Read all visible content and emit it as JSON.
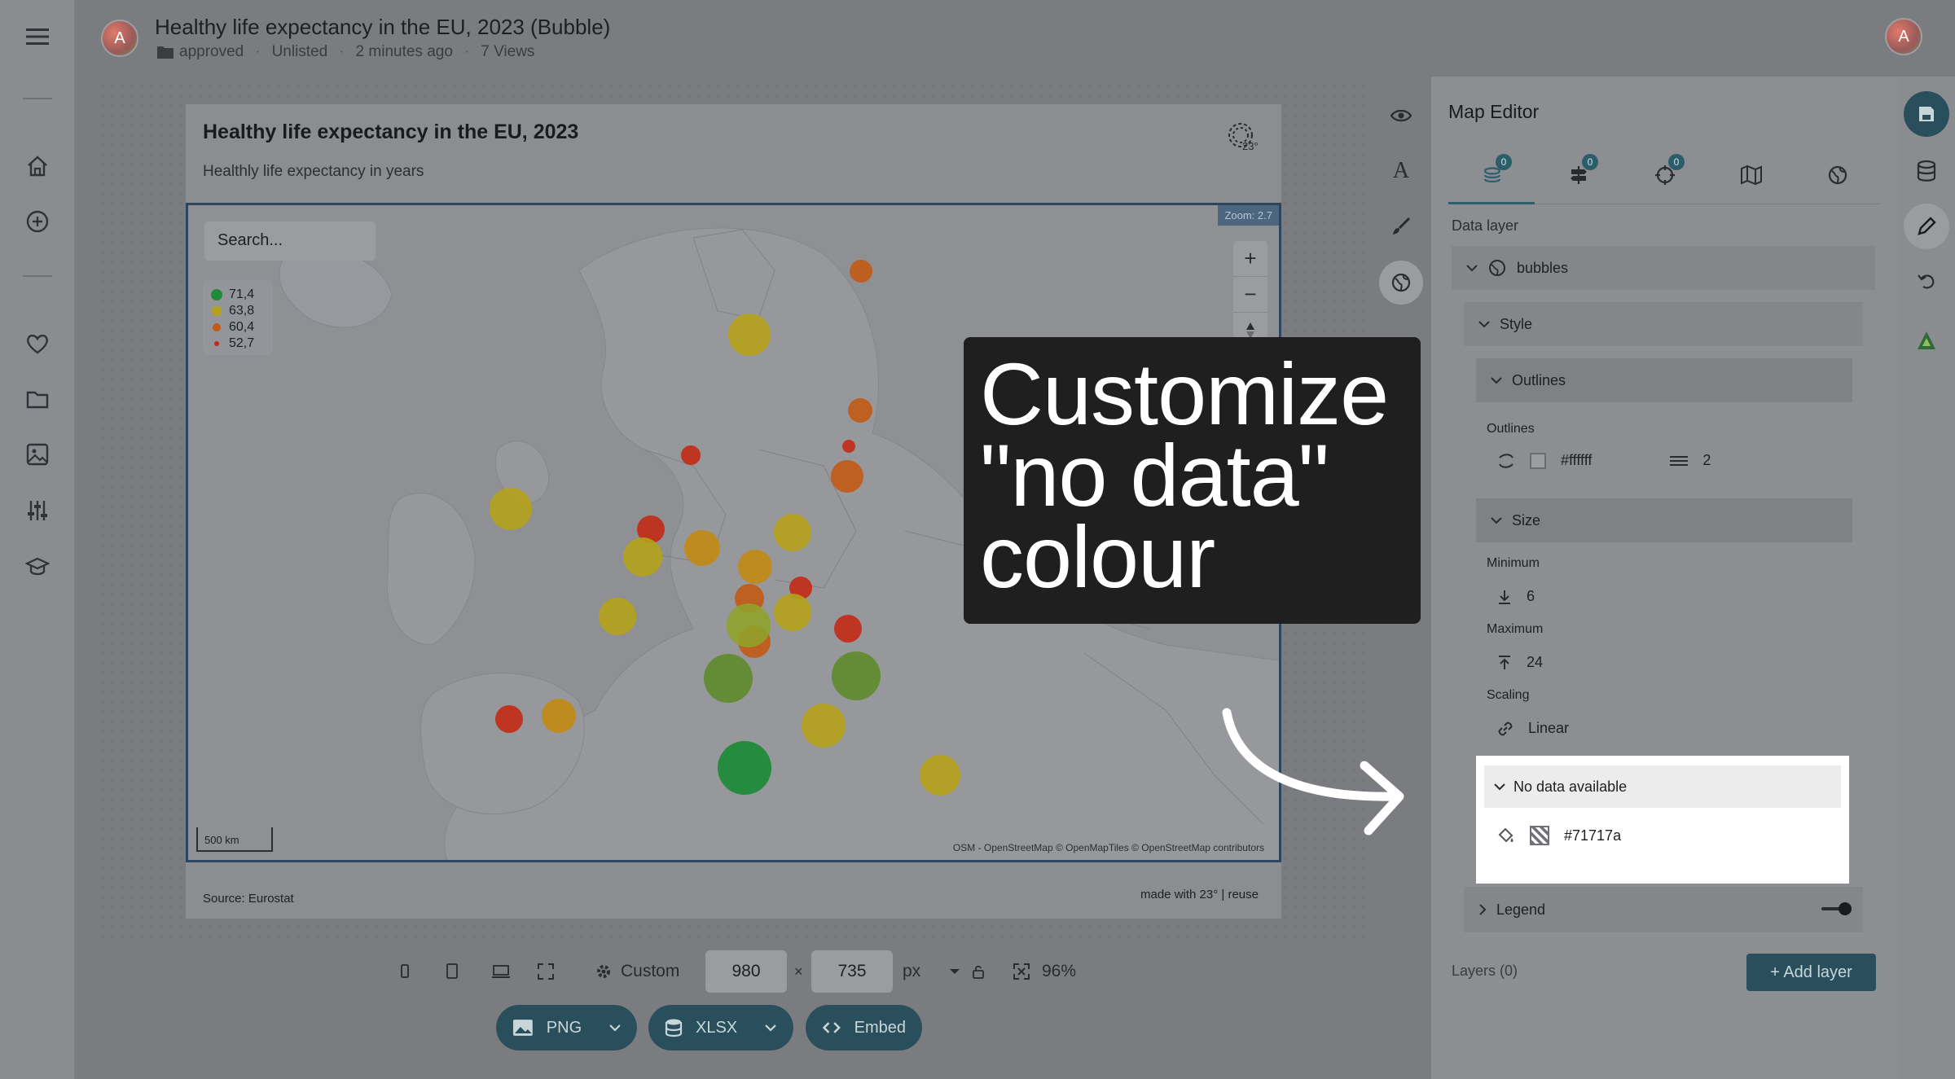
{
  "header": {
    "title": "Healthy life expectancy in the EU, 2023 (Bubble)",
    "status": "approved",
    "visibility": "Unlisted",
    "updated": "2 minutes ago",
    "views": "7 Views",
    "avatar_letter": "A"
  },
  "chart": {
    "title": "Healthy life expectancy in the EU, 2023",
    "subtitle": "Healthly life expectancy in years",
    "search_placeholder": "Search...",
    "legend": [
      {
        "value": "71,4",
        "color": "#1f8a3a"
      },
      {
        "value": "63,8",
        "color": "#b5a21a"
      },
      {
        "value": "60,4",
        "color": "#c25a14"
      },
      {
        "value": "52,7",
        "color": "#c22a14"
      }
    ],
    "zoom_label": "Zoom: 2.7",
    "scale": "500 km",
    "attribution": "OSM - OpenStreetMap   © OpenMapTiles © OpenStreetMap contributors",
    "source": "Source: Eurostat",
    "made_with": "made with 23° | reuse"
  },
  "overlay": {
    "line1": "Customize",
    "line2": "\"no data\"",
    "line3": "colour"
  },
  "bottom_bar": {
    "preset": "Custom",
    "width": "980",
    "height": "735",
    "unit": "px",
    "zoom": "96%",
    "png_label": "PNG",
    "xlsx_label": "XLSX",
    "embed_label": "Embed"
  },
  "panel": {
    "title": "Map Editor",
    "tab_badges": [
      "0",
      "0",
      "0"
    ],
    "data_layer_label": "Data layer",
    "layer_name": "bubbles",
    "style_label": "Style",
    "outlines_section": "Outlines",
    "outlines_label": "Outlines",
    "outline_color": "#ffffff",
    "outline_width": "2",
    "size_section": "Size",
    "minimum_label": "Minimum",
    "minimum_value": "6",
    "maximum_label": "Maximum",
    "maximum_value": "24",
    "scaling_label": "Scaling",
    "scaling_value": "Linear",
    "no_data_section": "No data available",
    "no_data_color": "#71717a",
    "legend_section": "Legend",
    "layers_count": "Layers (0)",
    "add_layer": "+ Add layer"
  },
  "colors": {
    "accent": "#2b5e6a",
    "bubble_green": "#1f8a3a",
    "bubble_yellow": "#b5a21a",
    "bubble_orange": "#c25a14",
    "bubble_red": "#c22a14"
  }
}
